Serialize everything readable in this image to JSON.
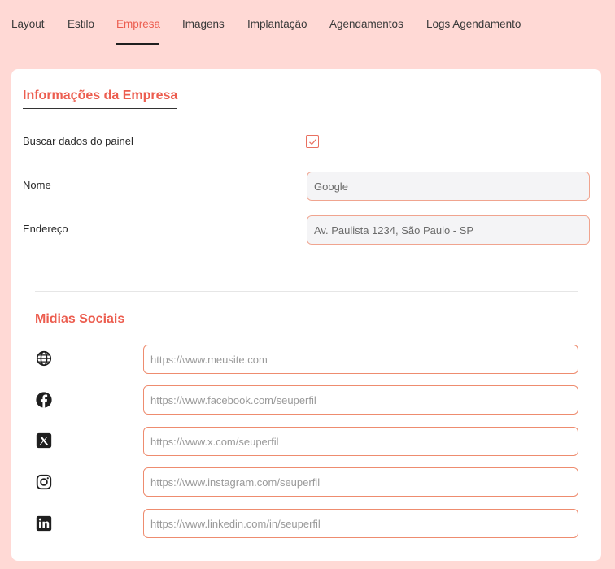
{
  "tabs": [
    "Layout",
    "Estilo",
    "Empresa",
    "Imagens",
    "Implantação",
    "Agendamentos",
    "Logs Agendamento"
  ],
  "active_tab": "Empresa",
  "company": {
    "title": "Informações da Empresa",
    "fetch_label": "Buscar dados do painel",
    "fetch_checked": true,
    "name_label": "Nome",
    "name_value": "Google",
    "address_label": "Endereço",
    "address_value": "Av. Paulista 1234, São Paulo - SP"
  },
  "social": {
    "title": "Midias Sociais",
    "items": [
      {
        "icon": "globe-icon",
        "placeholder": "https://www.meusite.com"
      },
      {
        "icon": "facebook-icon",
        "placeholder": "https://www.facebook.com/seuperfil"
      },
      {
        "icon": "x-icon",
        "placeholder": "https://www.x.com/seuperfil"
      },
      {
        "icon": "instagram-icon",
        "placeholder": "https://www.instagram.com/seuperfil"
      },
      {
        "icon": "linkedin-icon",
        "placeholder": "https://www.linkedin.com/in/seuperfil"
      }
    ]
  },
  "colors": {
    "background": "#ffd9d5",
    "accent": "#ec5d4f",
    "field_border": "#ee8c6f"
  }
}
